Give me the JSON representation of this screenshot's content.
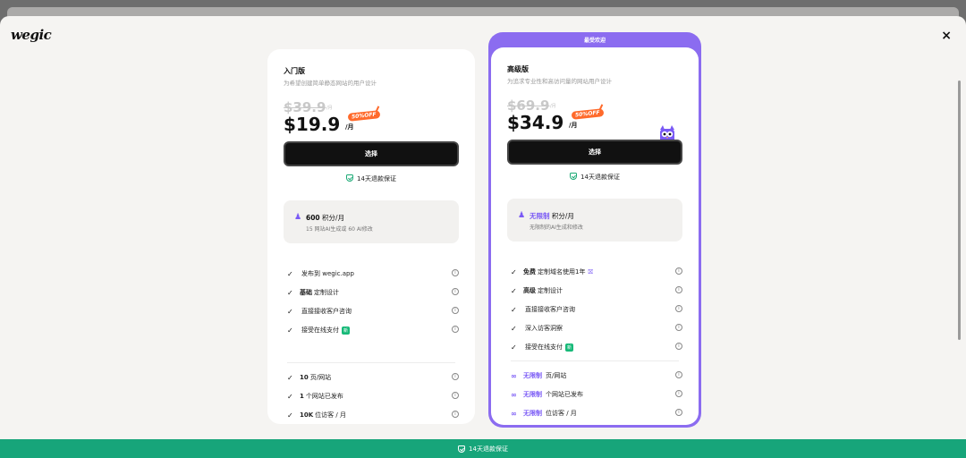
{
  "header": {
    "logo": "wegic",
    "close_label": "×"
  },
  "basic": {
    "name": "入门版",
    "desc": "为希望创建简单静态网站的用户设计",
    "old_price": "$39.9",
    "old_unit": "/月",
    "price": "$19.9",
    "price_unit": "/月",
    "discount": "50%OFF",
    "select_label": "选择",
    "guarantee": "14天退款保证",
    "credits_value": "600",
    "credits_label": "积分/月",
    "credits_sub": "15 网站AI生成或 60 AI修改",
    "features": [
      {
        "bold": "",
        "text": "发布到 wegic.app",
        "new": ""
      },
      {
        "bold": "基础",
        "text": "定制设计",
        "new": ""
      },
      {
        "bold": "",
        "text": "直接接收客户咨询",
        "new": ""
      },
      {
        "bold": "",
        "text": "接受在线支付",
        "new": "新"
      }
    ],
    "limits": [
      {
        "bold": "10",
        "text": "页/网站"
      },
      {
        "bold": "1",
        "text": "个网站已发布"
      },
      {
        "bold": "10K",
        "text": "位访客 / 月"
      }
    ]
  },
  "pro": {
    "badge": "最受欢迎",
    "name": "高级版",
    "desc": "为追求专业性和高访问量的网站用户设计",
    "old_price": "$69.9",
    "old_unit": "/月",
    "price": "$34.9",
    "price_unit": "/月",
    "discount": "50%OFF",
    "select_label": "选择",
    "guarantee": "14天退款保证",
    "credits_value": "无限制",
    "credits_label": "积分/月",
    "credits_sub": "无限制的AI生成和修改",
    "features": [
      {
        "bold": "免费",
        "text": "定制域名使用1年",
        "new": ""
      },
      {
        "bold": "高级",
        "text": "定制设计",
        "new": ""
      },
      {
        "bold": "",
        "text": "直接接收客户咨询",
        "new": ""
      },
      {
        "bold": "",
        "text": "深入访客洞察",
        "new": ""
      },
      {
        "bold": "",
        "text": "接受在线支付",
        "new": "新"
      }
    ],
    "limits": [
      {
        "bold": "无限制",
        "text": "页/网站"
      },
      {
        "bold": "无限制",
        "text": "个网站已发布"
      },
      {
        "bold": "无限制",
        "text": "位访客 / 月"
      }
    ]
  },
  "bottom_bar": {
    "label": "14天退款保证"
  },
  "colors": {
    "accent": "#8b6cf0",
    "success": "#17a57a",
    "discount": "#ff6a2b"
  }
}
